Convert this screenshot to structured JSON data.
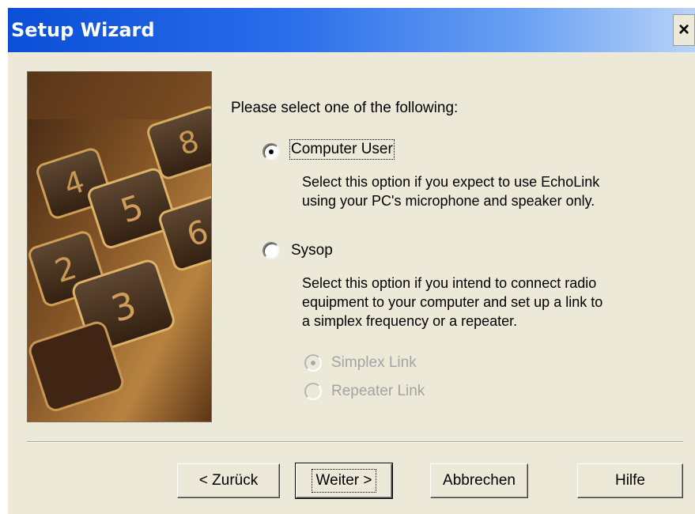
{
  "window": {
    "title": "Setup Wizard",
    "close_label": "×"
  },
  "banner": {
    "keys": [
      "8",
      "4",
      "5",
      "6",
      "2",
      "3"
    ]
  },
  "prompt": "Please select one of the following:",
  "options": [
    {
      "label": "Computer User",
      "selected": true,
      "description": [
        "Select this option if you expect to use EchoLink",
        "using your PC's microphone and speaker only."
      ]
    },
    {
      "label": "Sysop",
      "selected": false,
      "description": [
        "Select this option if you intend to connect radio",
        "equipment to your computer and set up a link to",
        "a simplex frequency or a repeater."
      ]
    }
  ],
  "sub_options": [
    {
      "label": "Simplex Link",
      "selected": true,
      "enabled": false
    },
    {
      "label": "Repeater Link",
      "selected": false,
      "enabled": false
    }
  ],
  "buttons": {
    "back": "< Zurück",
    "next": "Weiter >",
    "cancel": "Abbrechen",
    "help": "Hilfe"
  }
}
